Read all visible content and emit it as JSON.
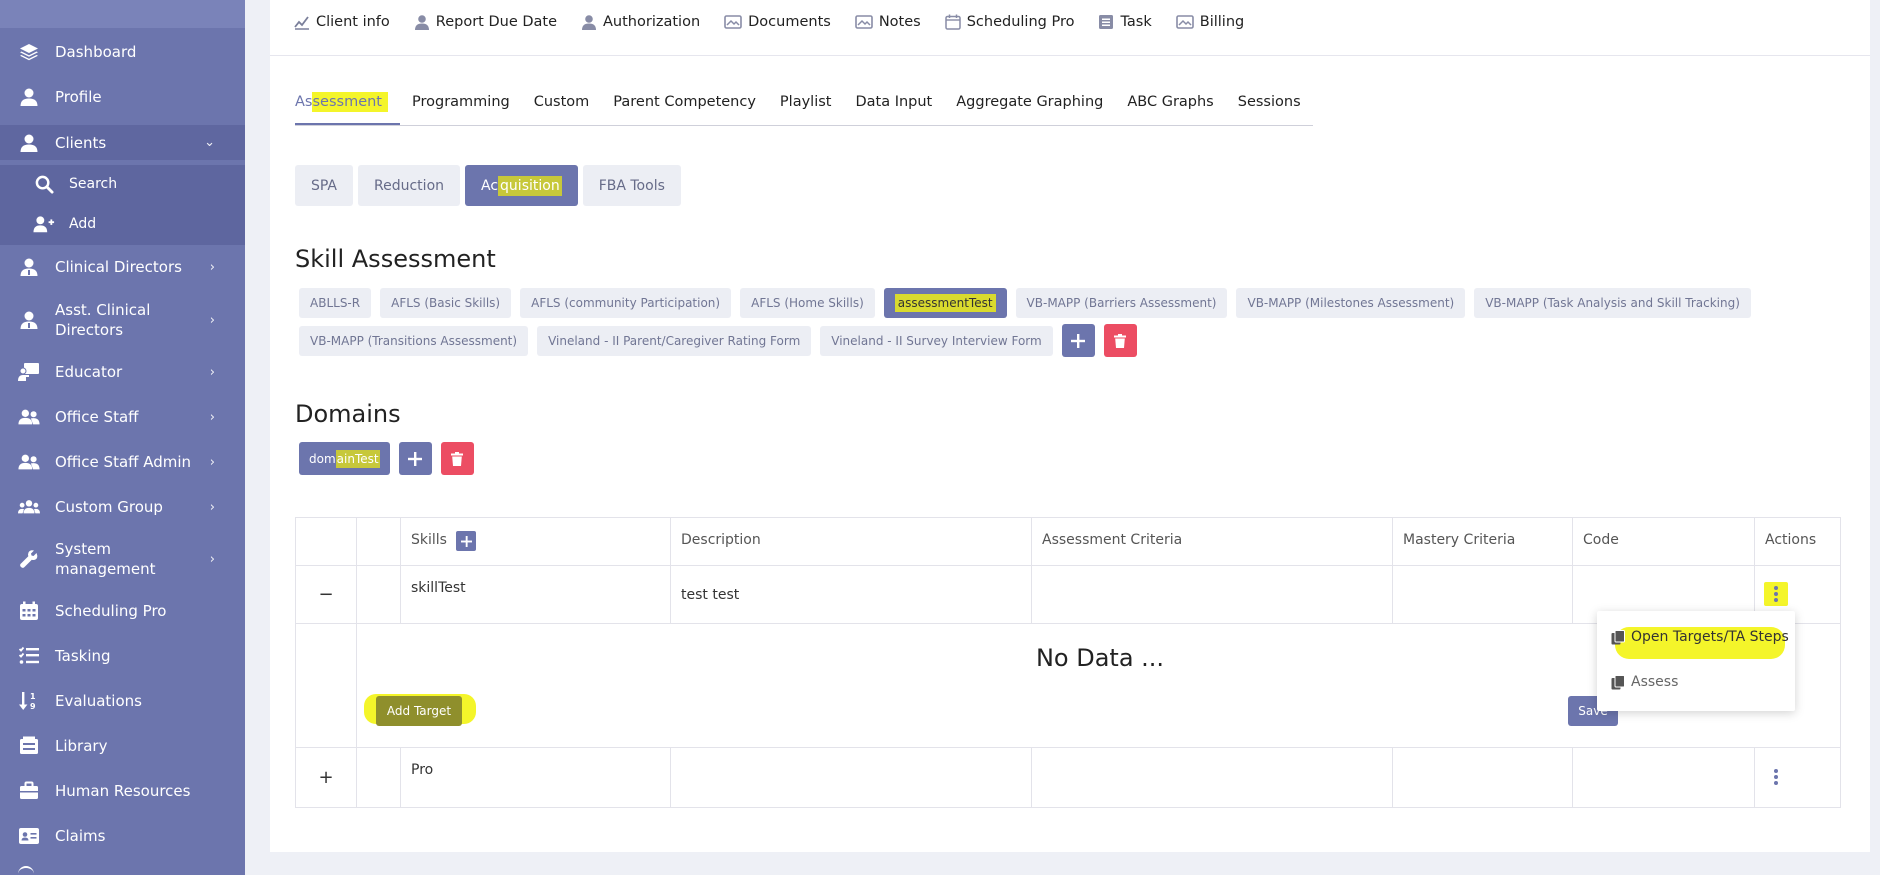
{
  "sidebar": {
    "items": [
      {
        "label": "Dashboard",
        "icon": "layers-icon"
      },
      {
        "label": "Profile",
        "icon": "user-icon"
      },
      {
        "label": "Clients",
        "icon": "user-icon",
        "expanded": true
      },
      {
        "label": "Search",
        "icon": "search-icon"
      },
      {
        "label": "Add",
        "icon": "user-plus-icon"
      },
      {
        "label": "Clinical Directors",
        "icon": "user-doctor-icon"
      },
      {
        "label_line1": "Asst. Clinical",
        "label_line2": "Directors",
        "icon": "user-doctor-icon"
      },
      {
        "label": "Educator",
        "icon": "chalkboard-teacher-icon"
      },
      {
        "label": "Office Staff",
        "icon": "users-icon"
      },
      {
        "label": "Office Staff Admin",
        "icon": "users-icon"
      },
      {
        "label": "Custom Group",
        "icon": "group-icon"
      },
      {
        "label_line1": "System",
        "label_line2": "management",
        "icon": "wrench-icon"
      },
      {
        "label": "Scheduling Pro",
        "icon": "calendar-icon"
      },
      {
        "label": "Tasking",
        "icon": "list-check-icon"
      },
      {
        "label": "Evaluations",
        "icon": "sort-numeric-icon"
      },
      {
        "label": "Library",
        "icon": "library-icon"
      },
      {
        "label": "Human Resources",
        "icon": "briefcase-icon"
      },
      {
        "label": "Claims",
        "icon": "id-card-icon"
      }
    ]
  },
  "topnav": {
    "items": [
      "Client info",
      "Report Due Date",
      "Authorization",
      "Documents",
      "Notes",
      "Scheduling Pro",
      "Task",
      "Billing"
    ]
  },
  "tabs": {
    "items": [
      "Assessment",
      "Programming",
      "Custom",
      "Parent Competency",
      "Playlist",
      "Data Input",
      "Aggregate Graphing",
      "ABC Graphs",
      "Sessions"
    ],
    "active": "Assessment"
  },
  "subtabs": {
    "items": [
      "SPA",
      "Reduction",
      "Acquisition",
      "FBA Tools"
    ],
    "active": "Acquisition"
  },
  "skill_assessment": {
    "title": "Skill Assessment",
    "chips_row1": [
      "ABLLS-R",
      "AFLS (Basic Skills)",
      "AFLS (community Participation)",
      "AFLS (Home Skills)",
      "assessmentTest",
      "VB-MAPP (Barriers Assessment)",
      "VB-MAPP (Milestones Assessment)",
      "VB-MAPP (Task Analysis and Skill Tracking)"
    ],
    "chips_row2": [
      "VB-MAPP (Transitions Assessment)",
      "Vineland - II Parent/Caregiver Rating Form",
      "Vineland - II Survey Interview Form"
    ],
    "active": "assessmentTest"
  },
  "domains": {
    "title": "Domains",
    "chips": [
      "domainTest"
    ]
  },
  "table": {
    "headers": {
      "skills": "Skills",
      "description": "Description",
      "assessment_criteria": "Assessment Criteria",
      "mastery_criteria": "Mastery Criteria",
      "code": "Code",
      "actions": "Actions"
    },
    "rows": [
      {
        "toggle": "−",
        "skill": "skillTest",
        "description": "test test"
      },
      {
        "toggle": "+",
        "skill": "Pro",
        "description": ""
      }
    ],
    "expanded": {
      "empty_text": "No Data ...",
      "add_target_label": "Add Target",
      "save_label": "Save"
    }
  },
  "popup": {
    "items": [
      "Open Targets/TA Steps",
      "Assess"
    ]
  },
  "colors": {
    "sidebar": "#6c75ad",
    "accent": "#6c75ad",
    "danger": "#ec4d63",
    "highlight": "#f4f52a"
  }
}
